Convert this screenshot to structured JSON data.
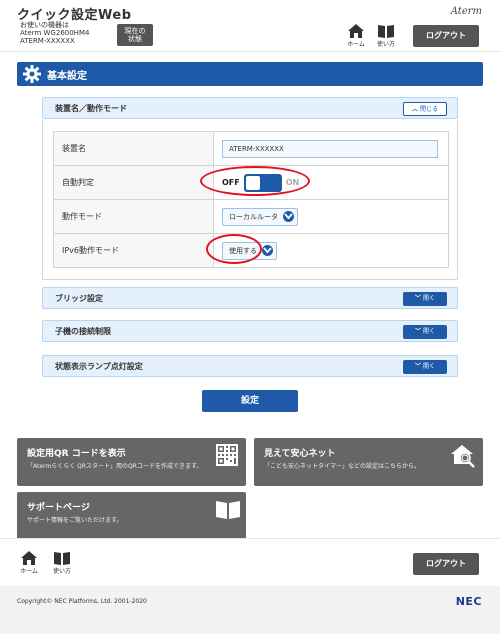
{
  "header": {
    "app_title": "クイック設定Web",
    "device_caption": "お使いの機器は",
    "device_model": "Aterm WG2600HM4",
    "device_name": "ATERM-XXXXXX",
    "status_button_line1": "現在の",
    "status_button_line2": "状態",
    "brand": "Aterm",
    "home_label": "ホーム",
    "manual_label": "使い方",
    "logout_label": "ログアウト"
  },
  "page": {
    "title": "基本設定"
  },
  "section_device": {
    "title": "装置名／動作モード",
    "toggle_label": "閉じる",
    "rows": {
      "device_name_label": "装置名",
      "device_name_value": "ATERM-XXXXXX",
      "auto_detect_label": "自動判定",
      "auto_off": "OFF",
      "auto_on": "ON",
      "op_mode_label": "動作モード",
      "op_mode_value": "ローカルルータ",
      "ipv6_label": "IPv6動作モード",
      "ipv6_value": "使用する"
    }
  },
  "sections_collapsed": [
    {
      "title": "ブリッジ設定",
      "toggle_label": "開く"
    },
    {
      "title": "子機の接続制限",
      "toggle_label": "開く"
    },
    {
      "title": "状態表示ランプ点灯設定",
      "toggle_label": "開く"
    }
  ],
  "apply_label": "設定",
  "cards": {
    "qr_title": "設定用QR コードを表示",
    "qr_desc": "「Atermらくらく QRスタート」用のQRコードを作成できます。",
    "safety_title": "見えて安心ネット",
    "safety_desc": "「こども安心ネットタイマー」などの設定はこちらから。",
    "support_title": "サポートページ",
    "support_desc": "サポート情報をご覧いただけます。"
  },
  "footer": {
    "home_label": "ホーム",
    "manual_label": "使い方",
    "logout_label": "ログアウト",
    "copyright": "Copyright© NEC Platforms, Ltd. 2001-2020",
    "nec_logo": "NEC"
  },
  "colors": {
    "primary_blue": "#1e5aa8",
    "highlight_red": "#e0141e",
    "card_gray": "#666666"
  }
}
